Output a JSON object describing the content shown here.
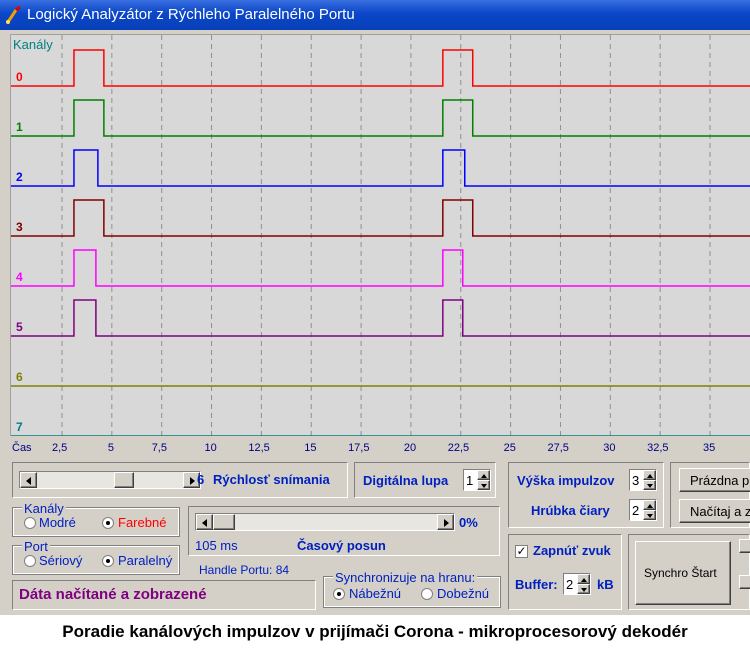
{
  "window": {
    "title": "Logický Analyzátor z Rýchleho Paralelného Portu"
  },
  "plot": {
    "channels_label": "Kanály",
    "channels": [
      {
        "id": "0",
        "color": "#ff0000"
      },
      {
        "id": "1",
        "color": "#008000"
      },
      {
        "id": "2",
        "color": "#0000ff"
      },
      {
        "id": "3",
        "color": "#800000"
      },
      {
        "id": "4",
        "color": "#ff00ff"
      },
      {
        "id": "5",
        "color": "#800080"
      },
      {
        "id": "6",
        "color": "#808000"
      },
      {
        "id": "7",
        "color": "#008080"
      }
    ],
    "grid_color": "#909090",
    "background": "#d8d8d8"
  },
  "time_axis": {
    "label": "Čas",
    "ticks": [
      "2,5",
      "5",
      "7,5",
      "10",
      "12,5",
      "15",
      "17,5",
      "20",
      "22,5",
      "25",
      "27,5",
      "30",
      "32,5",
      "35"
    ]
  },
  "pulses": {
    "units": "ms",
    "channels": [
      [
        [
          3.1,
          4.6
        ],
        [
          21.6,
          23.1
        ]
      ],
      [
        [
          3.1,
          4.6
        ],
        [
          21.6,
          23.1
        ]
      ],
      [
        [
          3.1,
          4.3
        ],
        [
          21.6,
          22.7
        ]
      ],
      [
        [
          3.1,
          4.6
        ],
        [
          21.6,
          23.1
        ]
      ],
      [
        [
          3.1,
          4.2
        ],
        [
          21.6,
          22.6
        ]
      ],
      [
        [
          3.1,
          4.2
        ],
        [
          21.6,
          22.6
        ]
      ],
      [],
      []
    ]
  },
  "speed": {
    "value": "6",
    "label": "Rýchlosť snímania"
  },
  "zoom": {
    "label": "Digitálna lupa",
    "value": "1"
  },
  "height": {
    "label": "Výška impulzov",
    "value": "3"
  },
  "thickness": {
    "label": "Hrúbka čiary",
    "value": "2"
  },
  "buttons": {
    "empty": "Prázdna p",
    "load": "Načítaj a z",
    "synchro": "Synchro Štart"
  },
  "channels_group": {
    "title": "Kanály",
    "blue": "Modré",
    "color": "Farebné"
  },
  "port_group": {
    "title": "Port",
    "serial": "Sériový",
    "parallel": "Paralelný"
  },
  "shift": {
    "percent": "0%",
    "ms": "105 ms",
    "label": "Časový posun",
    "fraction": 0
  },
  "sound": {
    "label": "Zapnúť zvuk",
    "checked": true
  },
  "buffer": {
    "label": "Buffer:",
    "value": "2",
    "unit": "kB"
  },
  "handle": {
    "label": "Handle Portu: 84"
  },
  "sync": {
    "title": "Synchronizuje na hranu:",
    "rising": "Nábežnú",
    "falling": "Dobežnú"
  },
  "status": {
    "text": "Dáta načítané a zobrazené"
  },
  "caption": {
    "text": "Poradie kanálových impulzov v prijímači Corona - mikroprocesorový dekodér"
  }
}
